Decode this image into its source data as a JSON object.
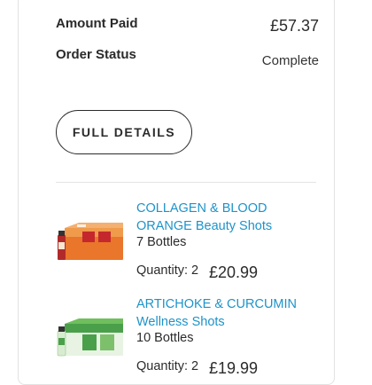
{
  "order": {
    "amount_paid_label": "Amount Paid",
    "amount_paid_value": "£57.37",
    "order_status_label": "Order Status",
    "order_status_value": "Complete",
    "full_details_label": "FULL DETAILS"
  },
  "products": [
    {
      "name": "COLLAGEN & BLOOD ORANGE Beauty Shots",
      "bottles": "7 Bottles",
      "quantity_label": "Quantity: 2",
      "price": "£20.99",
      "thumb_color": "#e9762b"
    },
    {
      "name": "ARTICHOKE & CURCUMIN Wellness Shots",
      "bottles": "10 Bottles",
      "quantity_label": "Quantity: 2",
      "price": "£19.99",
      "thumb_color": "#4aa04a"
    }
  ],
  "colors": {
    "link": "#1d93c9",
    "text": "#2b2b2b",
    "border": "#e2e2e2"
  }
}
